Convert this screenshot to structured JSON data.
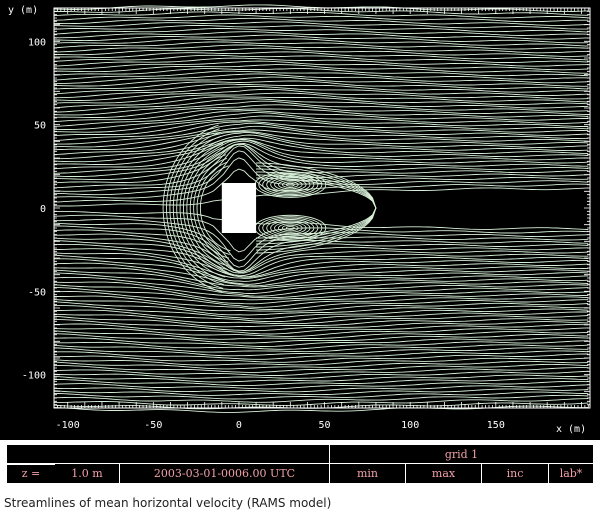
{
  "figure": {
    "x_axis_label": "x (m)",
    "y_axis_label": "y (m)",
    "x_ticks": [
      -100,
      -50,
      0,
      50,
      100,
      150
    ],
    "y_ticks": [
      100,
      50,
      0,
      -50,
      -100
    ],
    "x_range": [
      -108,
      205
    ],
    "y_range": [
      -120,
      120
    ],
    "obstacle": {
      "x_range": [
        -10,
        10
      ],
      "y_range": [
        -15,
        15
      ],
      "color": "#ffffff"
    },
    "streamline_color": "#d8f0d8",
    "background_color": "#000000"
  },
  "info_bar": {
    "grid_label": "grid 1",
    "z_label": "z =",
    "z_value": "1.0 m",
    "datetime": "2003-03-01-0006.00 UTC",
    "min_label": "min",
    "max_label": "max",
    "inc_label": "inc",
    "lab_label": "lab*",
    "text_color": "#f0a0a8"
  },
  "caption": "Streamlines of mean horizontal velocity (RAMS model)"
}
